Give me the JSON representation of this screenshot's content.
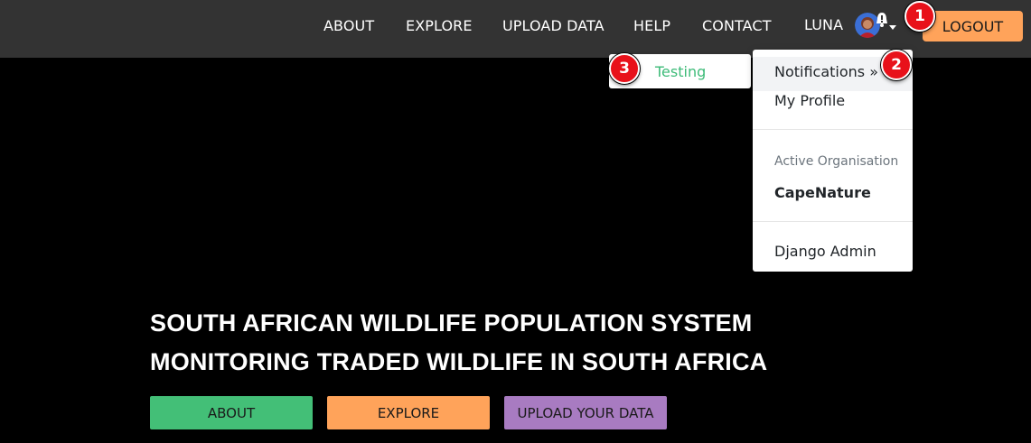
{
  "colors": {
    "navbar_bg": "#333333",
    "page_bg": "#000000",
    "logout_bg": "#ffa35a",
    "about_btn": "#43bf77",
    "explore_btn": "#ffa35a",
    "upload_btn": "#a87bc1",
    "testing_text": "#3dbb78",
    "marker_red": "#e8111a"
  },
  "nav": {
    "about": "ABOUT",
    "explore": "EXPLORE",
    "upload_data": "UPLOAD DATA",
    "help": "HELP",
    "contact": "CONTACT",
    "username": "LUNA",
    "avatar_icon": "user-avatar-icon",
    "notification_icon": "bell-alert-icon",
    "logout": "LOGOUT"
  },
  "dropdown": {
    "notifications": "Notifications »",
    "my_profile": "My Profile",
    "active_org_header": "Active Organisation",
    "active_org": "CapeNature",
    "django_admin": "Django Admin"
  },
  "submenu": {
    "testing": "Testing"
  },
  "markers": [
    "1",
    "2",
    "3"
  ],
  "hero": {
    "title_line1": "SOUTH AFRICAN WILDLIFE POPULATION SYSTEM",
    "title_line2": "MONITORING TRADED WILDLIFE IN SOUTH AFRICA",
    "about_btn": "ABOUT",
    "explore_btn": "EXPLORE",
    "upload_btn": "UPLOAD YOUR DATA"
  }
}
